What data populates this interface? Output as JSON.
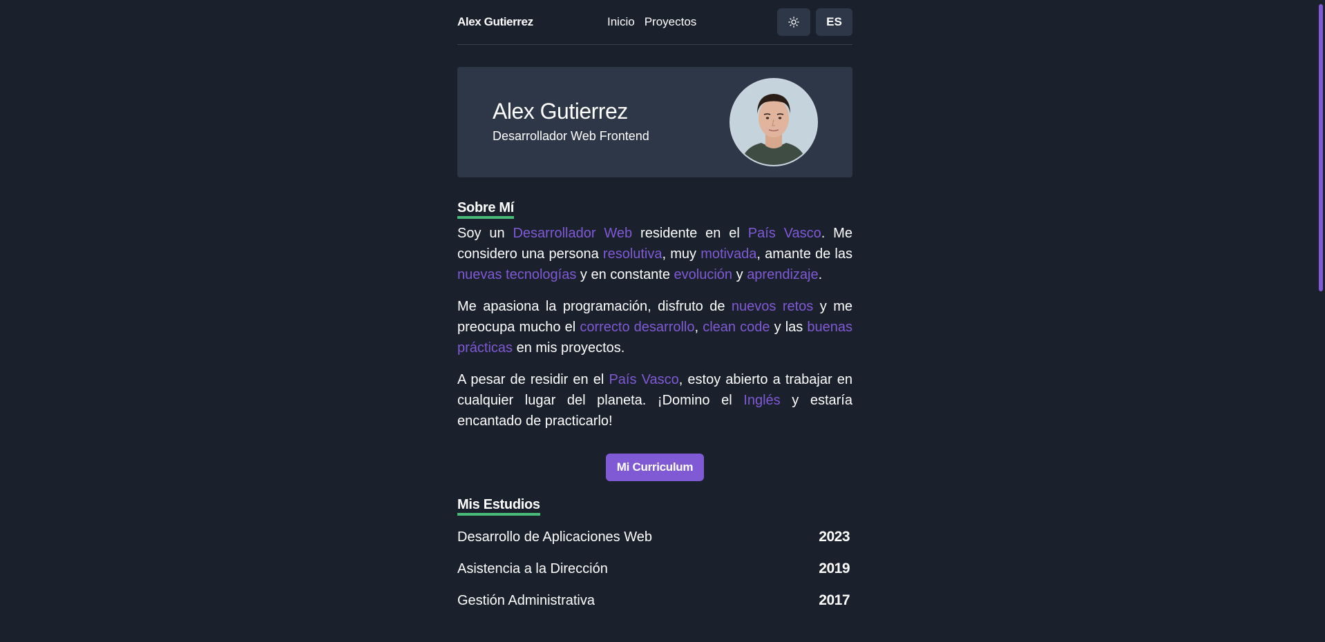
{
  "nav": {
    "brand": "Alex Gutierrez",
    "links": [
      "Inicio",
      "Proyectos"
    ],
    "theme_icon": "sun-icon",
    "lang": "ES"
  },
  "hero": {
    "name": "Alex Gutierrez",
    "role": "Desarrollador Web Frontend"
  },
  "about": {
    "title": "Sobre Mí",
    "p1": [
      {
        "t": "Soy un "
      },
      {
        "t": "Desarrollador Web",
        "hl": true
      },
      {
        "t": " residente en el "
      },
      {
        "t": "País Vasco",
        "hl": true
      },
      {
        "t": ". Me considero una persona "
      },
      {
        "t": "resolutiva",
        "hl": true
      },
      {
        "t": ", muy "
      },
      {
        "t": "motivada",
        "hl": true
      },
      {
        "t": ", amante de las "
      },
      {
        "t": "nuevas tecnologías",
        "hl": true
      },
      {
        "t": " y en constante "
      },
      {
        "t": "evolución",
        "hl": true
      },
      {
        "t": " y "
      },
      {
        "t": "aprendizaje",
        "hl": true
      },
      {
        "t": "."
      }
    ],
    "p2": [
      {
        "t": "Me apasiona la programación, disfruto de "
      },
      {
        "t": "nuevos retos",
        "hl": true
      },
      {
        "t": " y me preocupa mucho el "
      },
      {
        "t": "correcto desarrollo",
        "hl": true
      },
      {
        "t": ", "
      },
      {
        "t": "clean code",
        "hl": true
      },
      {
        "t": " y las "
      },
      {
        "t": "buenas prácticas",
        "hl": true
      },
      {
        "t": " en mis proyectos."
      }
    ],
    "p3": [
      {
        "t": "A pesar de residir en el "
      },
      {
        "t": "País Vasco",
        "hl": true
      },
      {
        "t": ", estoy abierto a trabajar en cualquier lugar del planeta. ¡Domino el "
      },
      {
        "t": "Inglés",
        "hl": true
      },
      {
        "t": " y estaría encantado de practicarlo!"
      }
    ],
    "cv_button": "Mi Curriculum"
  },
  "studies": {
    "title": "Mis Estudios",
    "items": [
      {
        "name": "Desarrollo de Aplicaciones Web",
        "year": "2023"
      },
      {
        "name": "Asistencia a la Dirección",
        "year": "2019"
      },
      {
        "name": "Gestión Administrativa",
        "year": "2017"
      }
    ]
  },
  "colors": {
    "background": "#1a202c",
    "card": "#2d3748",
    "accent": "#805ad5",
    "underline": "#48bb78"
  }
}
